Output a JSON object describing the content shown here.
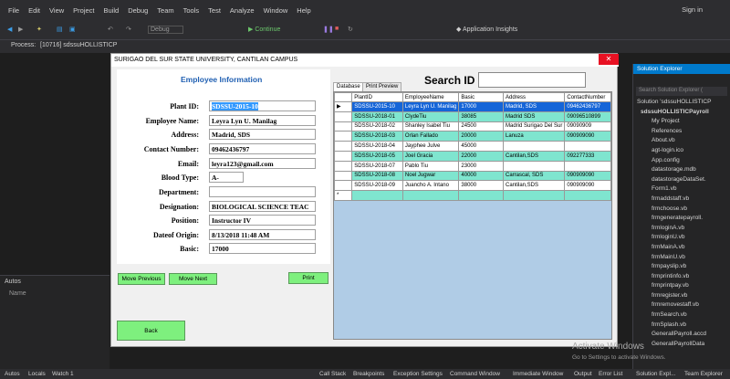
{
  "ide": {
    "menu": [
      "File",
      "Edit",
      "View",
      "Project",
      "Build",
      "Debug",
      "Team",
      "Tools",
      "Test",
      "Analyze",
      "Window",
      "Help"
    ],
    "sign_in": "Sign in",
    "toolbar": {
      "debug_label": "Debug",
      "continue_label": "Continue",
      "insights_label": "Application Insights"
    },
    "process_label": "Process:",
    "process_value": "[10716] sdssuHOLLISTICP",
    "autos_title": "Autos",
    "autos_col": "Name",
    "bottom_tabs": [
      "Autos",
      "Locals",
      "Watch 1"
    ],
    "right_tabs": [
      "Call Stack",
      "Breakpoints",
      "Exception Settings",
      "Command Window",
      "Immediate Window",
      "Output",
      "Error List",
      "Solution Expl...",
      "Team Explorer"
    ]
  },
  "solution_explorer": {
    "title": "Solution Explorer",
    "search_placeholder": "Search Solution Explorer (",
    "items": [
      "Solution 'sdssuHOLLISTICP",
      "sdssuHOLLISTICPayroll",
      "My Project",
      "References",
      "About.vb",
      "agt-login.ico",
      "App.config",
      "datastorage.mdb",
      "datastorageDataSet.",
      "Form1.vb",
      "frmaddstaff.vb",
      "frmchoose.vb",
      "frmgeneratepayroll.",
      "frmloginA.vb",
      "frmloginU.vb",
      "frmMainA.vb",
      "frmMainU.vb",
      "frmpayslip.vb",
      "frmprintinfo.vb",
      "frmprintpay.vb",
      "frmregister.vb",
      "frmremovestaff.vb",
      "frmSearch.vb",
      "frmSplash.vb",
      "GenerallPayroll.accd",
      "GenerallPayrollData"
    ]
  },
  "form": {
    "title": "SURIGAO DEL SUR STATE UNIVERSITY, CANTILAN CAMPUS",
    "close": "✕",
    "panel_title": "Employee Information",
    "fields": [
      {
        "label": "Plant ID:",
        "value": "SDSSU-2015-10"
      },
      {
        "label": "Employee Name:",
        "value": "Leyra Lyn U. Manilag"
      },
      {
        "label": "Address:",
        "value": "Madrid, SDS"
      },
      {
        "label": "Contact Number:",
        "value": "09462436797"
      },
      {
        "label": "Email:",
        "value": "leyra123@gmail.com"
      },
      {
        "label": "Blood Type:",
        "value": "A-"
      },
      {
        "label": "Department:",
        "value": ""
      },
      {
        "label": "Designation:",
        "value": "BIOLOGICAL SCIENCE TEAC"
      },
      {
        "label": "Position:",
        "value": "Instructor IV"
      },
      {
        "label": "Dateof Origin:",
        "value": "8/13/2018 11:48 AM"
      },
      {
        "label": "Basic:",
        "value": "17000"
      }
    ],
    "buttons": {
      "move_previous": "Move Previous",
      "move_next": "Move Next",
      "print": "Print",
      "back": "Back"
    },
    "search_label": "Search ID",
    "tabs": [
      "Database",
      "Print Preview"
    ],
    "grid": {
      "columns": [
        "PlantID",
        "EmployeeName",
        "Basic",
        "Address",
        "ContactNumber"
      ],
      "rows": [
        [
          "SDSSU-2015-10",
          "Leyra Lyn U. Manilag",
          "17000",
          "Madrid, SDS",
          "09462436797"
        ],
        [
          "SDSSU-2018-01",
          "ClydeTiu",
          "38085",
          "Madrid SDS",
          "09096510899"
        ],
        [
          "SDSSU-2018-02",
          "Shanley Isabel Tiu",
          "24500",
          "Madrid Surigao Del Sur",
          "09090909"
        ],
        [
          "SDSSU-2018-03",
          "Orlan Fallado",
          "20000",
          "Lanuza",
          "090909090"
        ],
        [
          "SDSSU-2018-04",
          "Jayphee Julve",
          "45000",
          "",
          ""
        ],
        [
          "SDSSU-2018-05",
          "Joel Gracia",
          "22000",
          "Cantilan,SDS",
          "092277333"
        ],
        [
          "SDSSU-2018-07",
          "Pablo Tiu",
          "23000",
          "",
          ""
        ],
        [
          "SDSSU-2018-08",
          "Noel Jugwar",
          "40000",
          "Carrascal, SDS",
          "090909090"
        ],
        [
          "SDSSU-2018-09",
          "Juancho A. Intano",
          "38000",
          "Cantilan,SDS",
          "090909090"
        ]
      ],
      "row_marker": "▶",
      "new_row_marker": "*"
    }
  },
  "watermark": {
    "title": "Activate Windows",
    "sub": "Go to Settings to activate Windows."
  }
}
